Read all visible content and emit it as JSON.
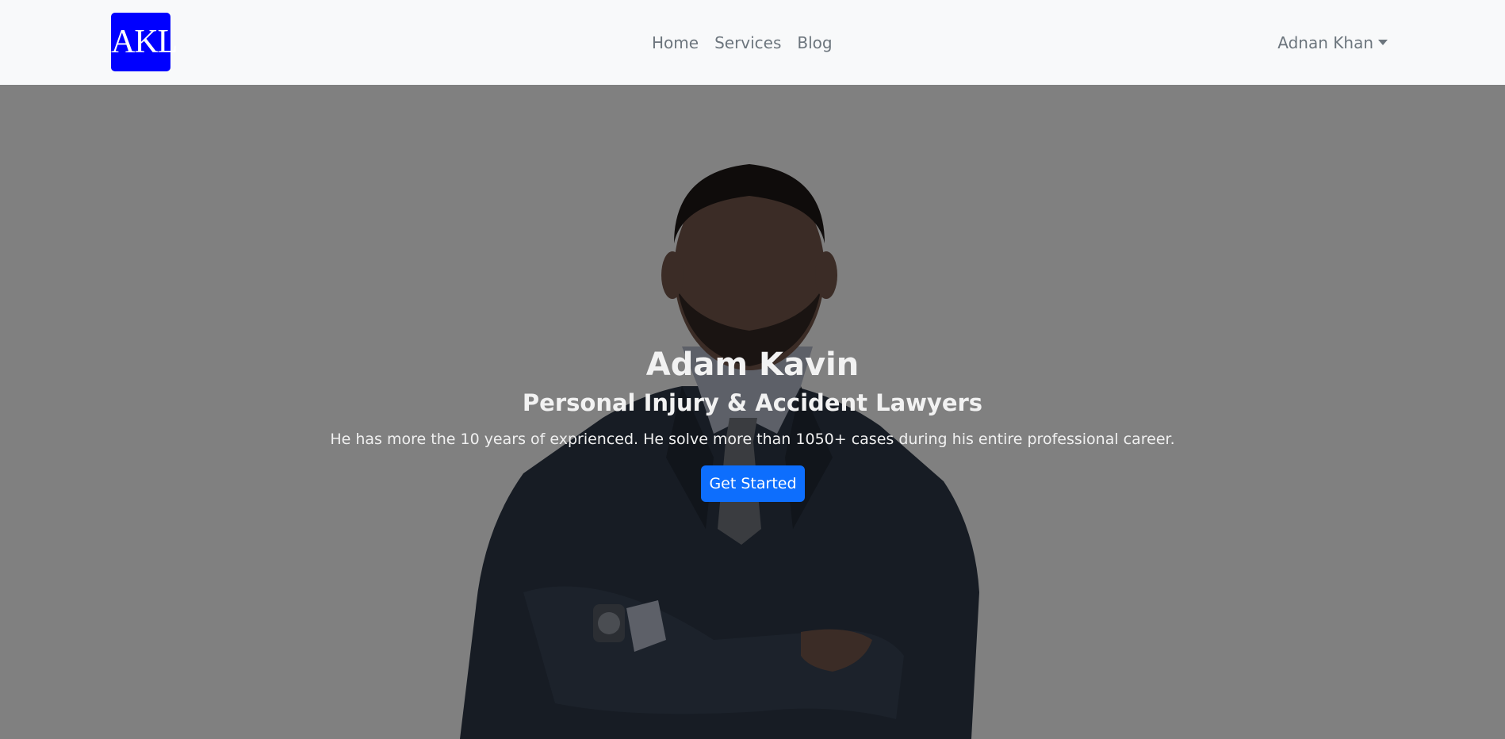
{
  "logo": {
    "text": "AKL",
    "color": "#0000ff"
  },
  "nav": {
    "links": [
      {
        "label": "Home"
      },
      {
        "label": "Services"
      },
      {
        "label": "Blog"
      }
    ],
    "user": {
      "label": "Adnan Khan",
      "icon": "caret-down-icon"
    }
  },
  "hero": {
    "title": "Adam Kavin",
    "subtitle": "Personal Injury & Accident Lawyers",
    "text": "He has more the 10 years of exprienced. He solve more than 1050+ cases during his entire professional career.",
    "cta_label": "Get Started",
    "overlay_color": "#808080",
    "button_color": "#0d6efd"
  }
}
